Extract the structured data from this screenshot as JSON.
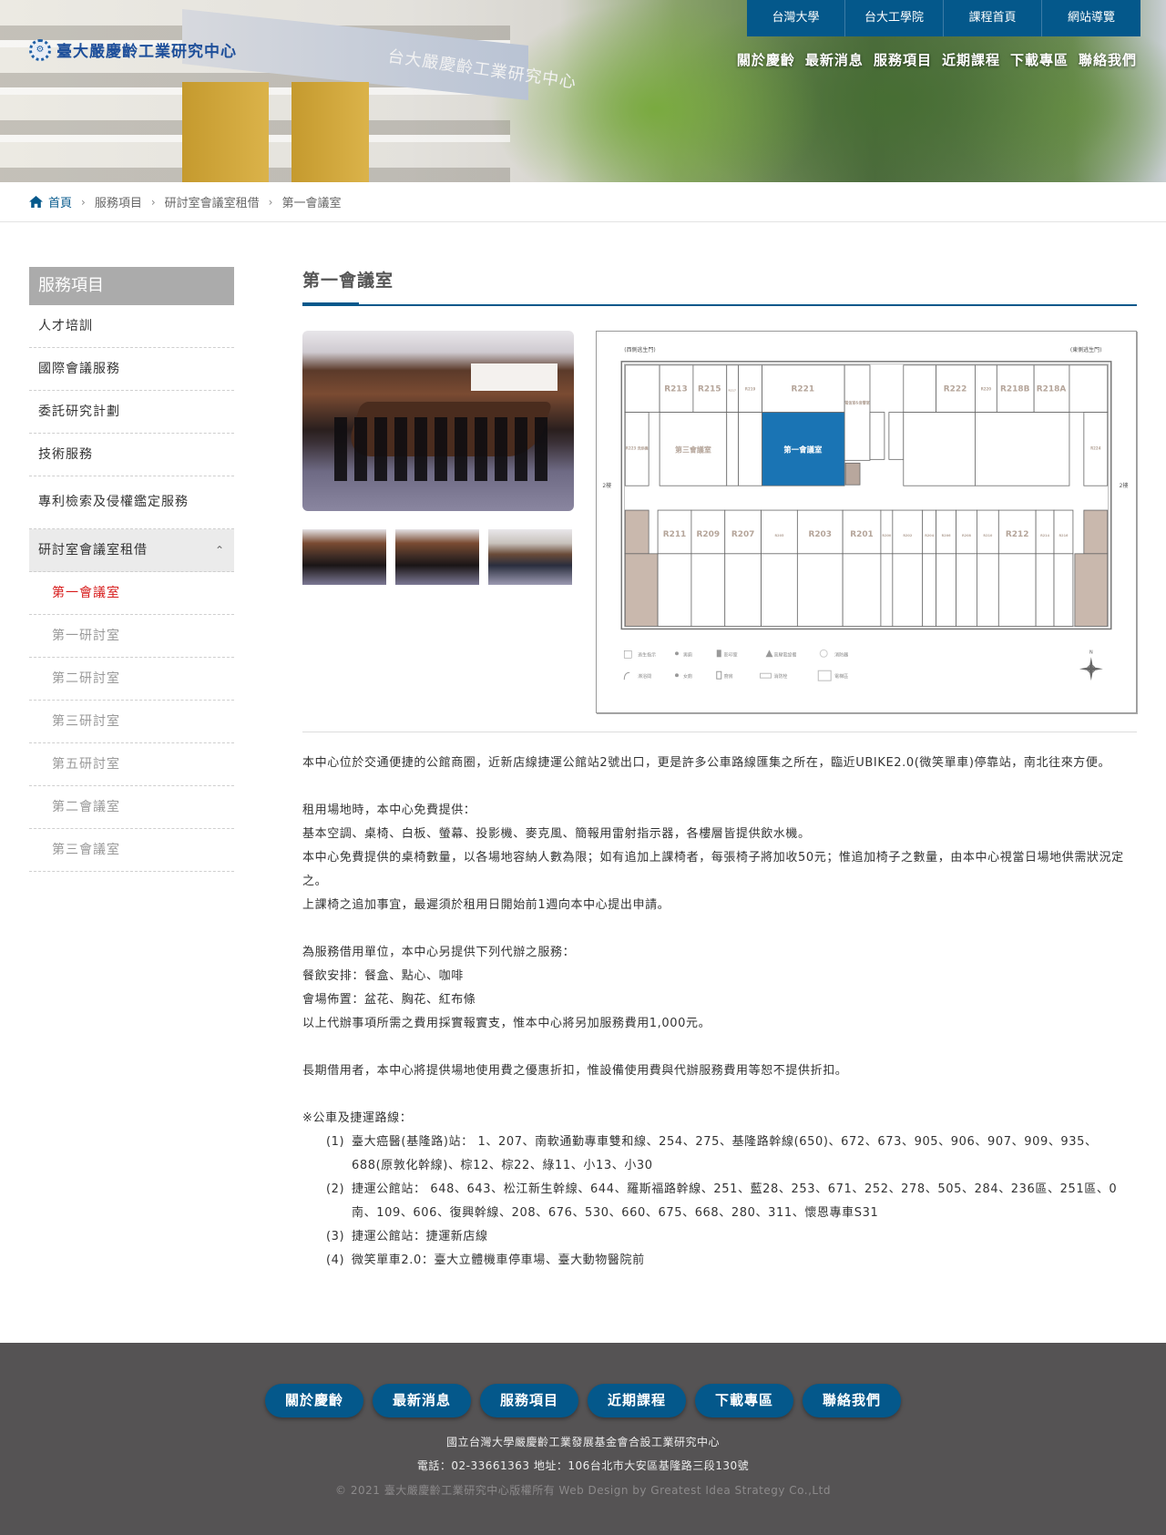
{
  "header": {
    "logo_text": "臺大嚴慶齡工業研究中心",
    "logo_icon": "gear-emblem-icon",
    "building_sign": "台大嚴慶齡工業研究中心",
    "top_links": [
      "台灣大學",
      "台大工學院",
      "課程首頁",
      "網站導覽"
    ],
    "main_nav": [
      "關於慶齡",
      "最新消息",
      "服務項目",
      "近期課程",
      "下載專區",
      "聯絡我們"
    ]
  },
  "breadcrumb": {
    "home_icon": "home-icon",
    "items": [
      "首頁",
      "服務項目",
      "研討室會議室租借",
      "第一會議室"
    ],
    "separator": "›"
  },
  "sidebar": {
    "title": "服務項目",
    "items": [
      {
        "label": "人才培訓"
      },
      {
        "label": "國際會議服務"
      },
      {
        "label": "委託研究計劃"
      },
      {
        "label": "技術服務"
      },
      {
        "label": "專利檢索及侵權鑑定服務"
      },
      {
        "label": "研討室會議室租借",
        "expanded": true
      }
    ],
    "chevron": "⌃",
    "sub_items": [
      {
        "label": "第一會議室",
        "active": true
      },
      {
        "label": "第一研討室"
      },
      {
        "label": "第二研討室"
      },
      {
        "label": "第三研討室"
      },
      {
        "label": "第五研討室"
      },
      {
        "label": "第二會議室"
      },
      {
        "label": "第三會議室"
      }
    ]
  },
  "main": {
    "title": "第一會議室",
    "gallery": {
      "main_photo": "conference-room-photo",
      "thumbnails": [
        "conference-room-thumb-1",
        "conference-room-thumb-2",
        "conference-room-thumb-3"
      ]
    },
    "floorplan": {
      "west_gate": "(西側逃生門)",
      "east_gate": "(東側逃生門)",
      "floor_label": "2樓",
      "highlight_room": "第一會議室",
      "top_rooms": [
        "R213",
        "R215",
        "R217",
        "R219",
        "R221",
        "電信室&音響室",
        "R222",
        "R220",
        "R218B",
        "R218A"
      ],
      "middle_rooms": [
        "R223 洗烘機",
        "第三會議室",
        "R224"
      ],
      "bottom_rooms": [
        "R211",
        "R209",
        "R207",
        "R205",
        "R203",
        "R201",
        "R200",
        "R202",
        "R204",
        "R206",
        "R208",
        "R210",
        "R212",
        "R214",
        "R216"
      ],
      "legend": [
        "逃生指示",
        "男廁",
        "影印室",
        "高壓電設備",
        "消防器",
        "淋浴間",
        "女廁",
        "廚房",
        "消防栓",
        "電梯區"
      ],
      "compass": "N"
    },
    "paragraphs": {
      "intro": "本中心位於交通便捷的公館商圈，近新店線捷運公館站2號出口，更是許多公車路線匯集之所在，臨近UBIKE2.0(微笑單車)停靠站，南北往來方便。",
      "free_title": "租用場地時，本中心免費提供：",
      "free_items": "基本空調、桌椅、白板、螢幕、投影機、麥克風、簡報用雷射指示器，各樓層皆提供飲水機。",
      "chairs": "本中心免費提供的桌椅數量，以各場地容納人數為限；如有追加上課椅者，每張椅子將加收50元；惟追加椅子之數量，由本中心視當日場地供需狀況定之。",
      "chairs_deadline": "上課椅之追加事宜，最遲須於租用日開始前1週向本中心提出申請。",
      "services_title": "為服務借用單位，本中心另提供下列代辦之服務：",
      "catering": "餐飲安排：餐盒、點心、咖啡",
      "decoration": "會場佈置：盆花、胸花、紅布條",
      "service_fee": "以上代辦事項所需之費用採實報實支，惟本中心將另加服務費用1,000元。",
      "long_term": "長期借用者，本中心將提供場地使用費之優惠折扣，惟設備使用費與代辦服務費用等恕不提供折扣。",
      "routes_title": "※公車及捷運路線："
    },
    "routes": [
      {
        "num": "(1)",
        "text": "臺大癌醫(基隆路)站： 1、207、南軟通勤專車雙和線、254、275、基隆路幹線(650)、672、673、905、906、907、909、935、688(原敦化幹線)、棕12、棕22、綠11、小13、小30"
      },
      {
        "num": "(2)",
        "text": "捷運公館站： 648、643、松江新生幹線、644、羅斯福路幹線、251、藍28、253、671、252、278、505、284、236區、251區、0南、109、606、復興幹線、208、676、530、660、675、668、280、311、懷恩專車S31"
      },
      {
        "num": "(3)",
        "text": "捷運公館站：捷運新店線"
      },
      {
        "num": "(4)",
        "text": "微笑單車2.0：臺大立體機車停車場、臺大動物醫院前"
      }
    ]
  },
  "footer": {
    "nav": [
      "關於慶齡",
      "最新消息",
      "服務項目",
      "近期課程",
      "下載專區",
      "聯絡我們"
    ],
    "org": "國立台灣大學嚴慶齡工業發展基金會合設工業研究中心",
    "contact": "電話：02-33661363 地址：106台北市大安區基隆路三段130號",
    "copyright": "© 2021 臺大嚴慶齡工業研究中心版權所有 Web Design by Greatest Idea Strategy Co.,Ltd"
  },
  "colors": {
    "brand_blue": "#04588b",
    "active_red": "#d71c1c",
    "sidebar_title_bg": "#ababab",
    "footer_bg": "#555354"
  }
}
